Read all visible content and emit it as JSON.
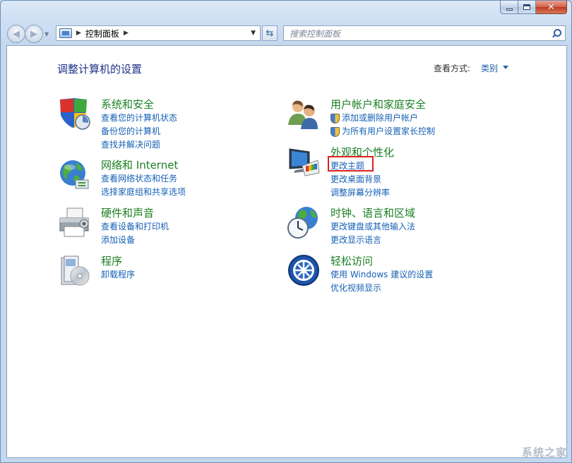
{
  "window": {
    "caption": {
      "min": "minimize",
      "max": "maximize",
      "close_glyph": "✕"
    }
  },
  "nav": {
    "back_icon": "back-arrow-icon",
    "forward_icon": "forward-arrow-icon",
    "address_path": "控制面板",
    "search_placeholder": "搜索控制面板"
  },
  "header": {
    "title": "调整计算机的设置",
    "view_by_label": "查看方式:",
    "view_by_value": "类别"
  },
  "categories_left": [
    {
      "title": "系统和安全",
      "icon": "shield-pc-icon",
      "links": [
        "查看您的计算机状态",
        "备份您的计算机",
        "查找并解决问题"
      ]
    },
    {
      "title": "网络和 Internet",
      "icon": "globe-network-icon",
      "links": [
        "查看网络状态和任务",
        "选择家庭组和共享选项"
      ]
    },
    {
      "title": "硬件和声音",
      "icon": "printer-icon",
      "links": [
        "查看设备和打印机",
        "添加设备"
      ]
    },
    {
      "title": "程序",
      "icon": "programs-disc-icon",
      "links": [
        "卸载程序"
      ]
    }
  ],
  "categories_right": [
    {
      "title": "用户帐户和家庭安全",
      "icon": "users-icon",
      "links": [
        "添加或删除用户帐户",
        "为所有用户设置家长控制"
      ]
    },
    {
      "title": "外观和个性化",
      "icon": "monitor-palette-icon",
      "links": [
        "更改主题",
        "更改桌面背景",
        "调整屏幕分辨率"
      ]
    },
    {
      "title": "时钟、语言和区域",
      "icon": "clock-globe-icon",
      "links": [
        "更改键盘或其他输入法",
        "更改显示语言"
      ]
    },
    {
      "title": "轻松访问",
      "icon": "ease-of-access-icon",
      "links": [
        "使用 Windows 建议的设置",
        "优化视频显示"
      ]
    }
  ],
  "watermark": "系统之家",
  "colors": {
    "title_green": "#1a7f22",
    "link_blue": "#1560b6",
    "highlight_red": "#e02020"
  }
}
